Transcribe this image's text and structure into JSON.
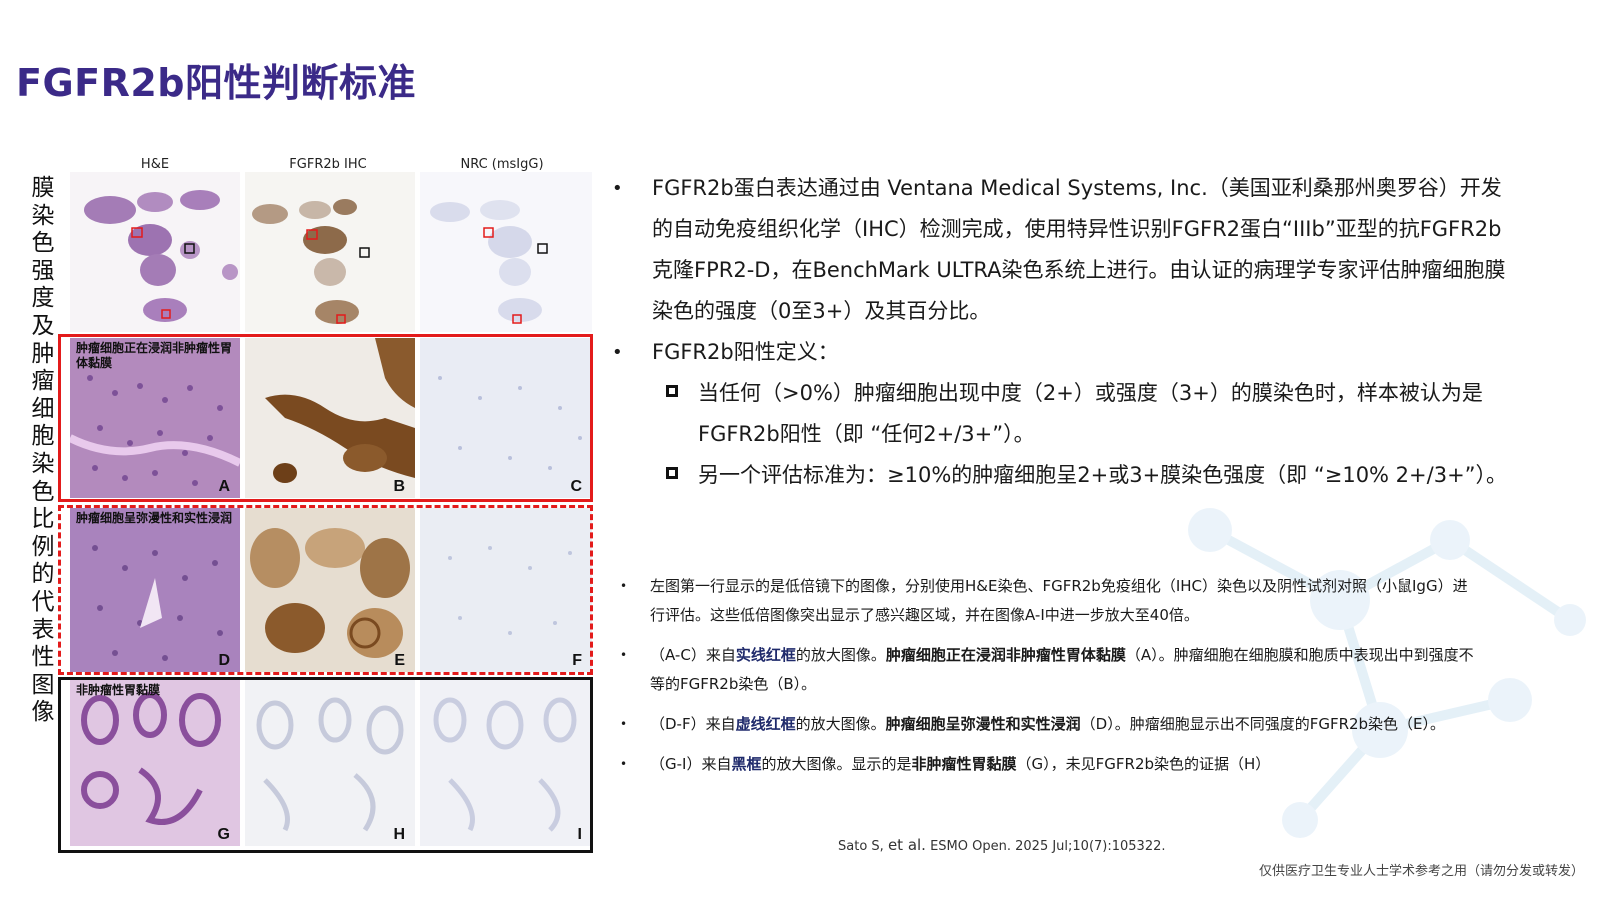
{
  "title": "FGFR2b阳性判断标准",
  "vertical_label": "膜染色强度及肿瘤细胞染色比例的代表性图像",
  "figure": {
    "column_headers": [
      "H&E",
      "FGFR2b IHC",
      "NRC (msIgG)"
    ],
    "row_captions": [
      "肿瘤细胞正在浸润非肿瘤性胃体黏膜",
      "肿瘤细胞呈弥漫性和实性浸润",
      "非肿瘤性胃黏膜"
    ],
    "panel_letters": [
      "A",
      "B",
      "C",
      "D",
      "E",
      "F",
      "G",
      "H",
      "I"
    ],
    "frame_colors": [
      "#e31b1b",
      "#e31b1b",
      "#111111"
    ]
  },
  "bullets": {
    "item1": "FGFR2b蛋白表达通过由 Ventana Medical Systems, Inc.（美国亚利桑那州奥罗谷）开发的自动免疫组织化学（IHC）检测完成，使用特异性识别FGFR2蛋白“IIIb”亚型的抗FGFR2b克隆FPR2-D，在BenchMark ULTRA染色系统上进行。由认证的病理学专家评估肿瘤细胞膜染色的强度（0至3+）及其百分比。",
    "item2": "FGFR2b阳性定义：",
    "sub1": "当任何（>0%）肿瘤细胞出现中度（2+）或强度（3+）的膜染色时，样本被认为是FGFR2b阳性（即 “任何2+/3+”）。",
    "sub2": "另一个评估标准为：≥10%的肿瘤细胞呈2+或3+膜染色强度（即 “≥10% 2+/3+”）。"
  },
  "notes": {
    "n1": "左图第一行显示的是低倍镜下的图像，分别使用H&E染色、FGFR2b免疫组化（IHC）染色以及阴性试剂对照（小鼠IgG）进行评估。这些低倍图像突出显示了感兴趣区域，并在图像A-I中进一步放大至40倍。",
    "n2_a": "（A-C）来自",
    "n2_b": "实线红框",
    "n2_c": "的放大图像。",
    "n2_d": "肿瘤细胞正在浸润非肿瘤性胃体黏膜",
    "n2_e": "（A）。肿瘤细胞在细胞膜和胞质中表现出中到强度不等的FGFR2b染色（B）。",
    "n3_a": "（D-F）来自",
    "n3_b": "虚线红框",
    "n3_c": "的放大图像。",
    "n3_d": "肿瘤细胞呈弥漫性和实性浸润",
    "n3_e": "（D）。肿瘤细胞显示出不同强度的FGFR2b染色（E）。",
    "n4_a": "（G-I）来自",
    "n4_b": "黑框",
    "n4_c": "的放大图像。显示的是",
    "n4_d": "非肿瘤性胃黏膜",
    "n4_e": "（G），未见FGFR2b染色的证据（H）"
  },
  "citation": {
    "authors": "Sato S,",
    "etal": "et al.",
    "source": "ESMO Open. 2025 Jul;10(7):105322."
  },
  "footer": "仅供医疗卫生专业人士学术参考之用（请勿分发或转发）"
}
